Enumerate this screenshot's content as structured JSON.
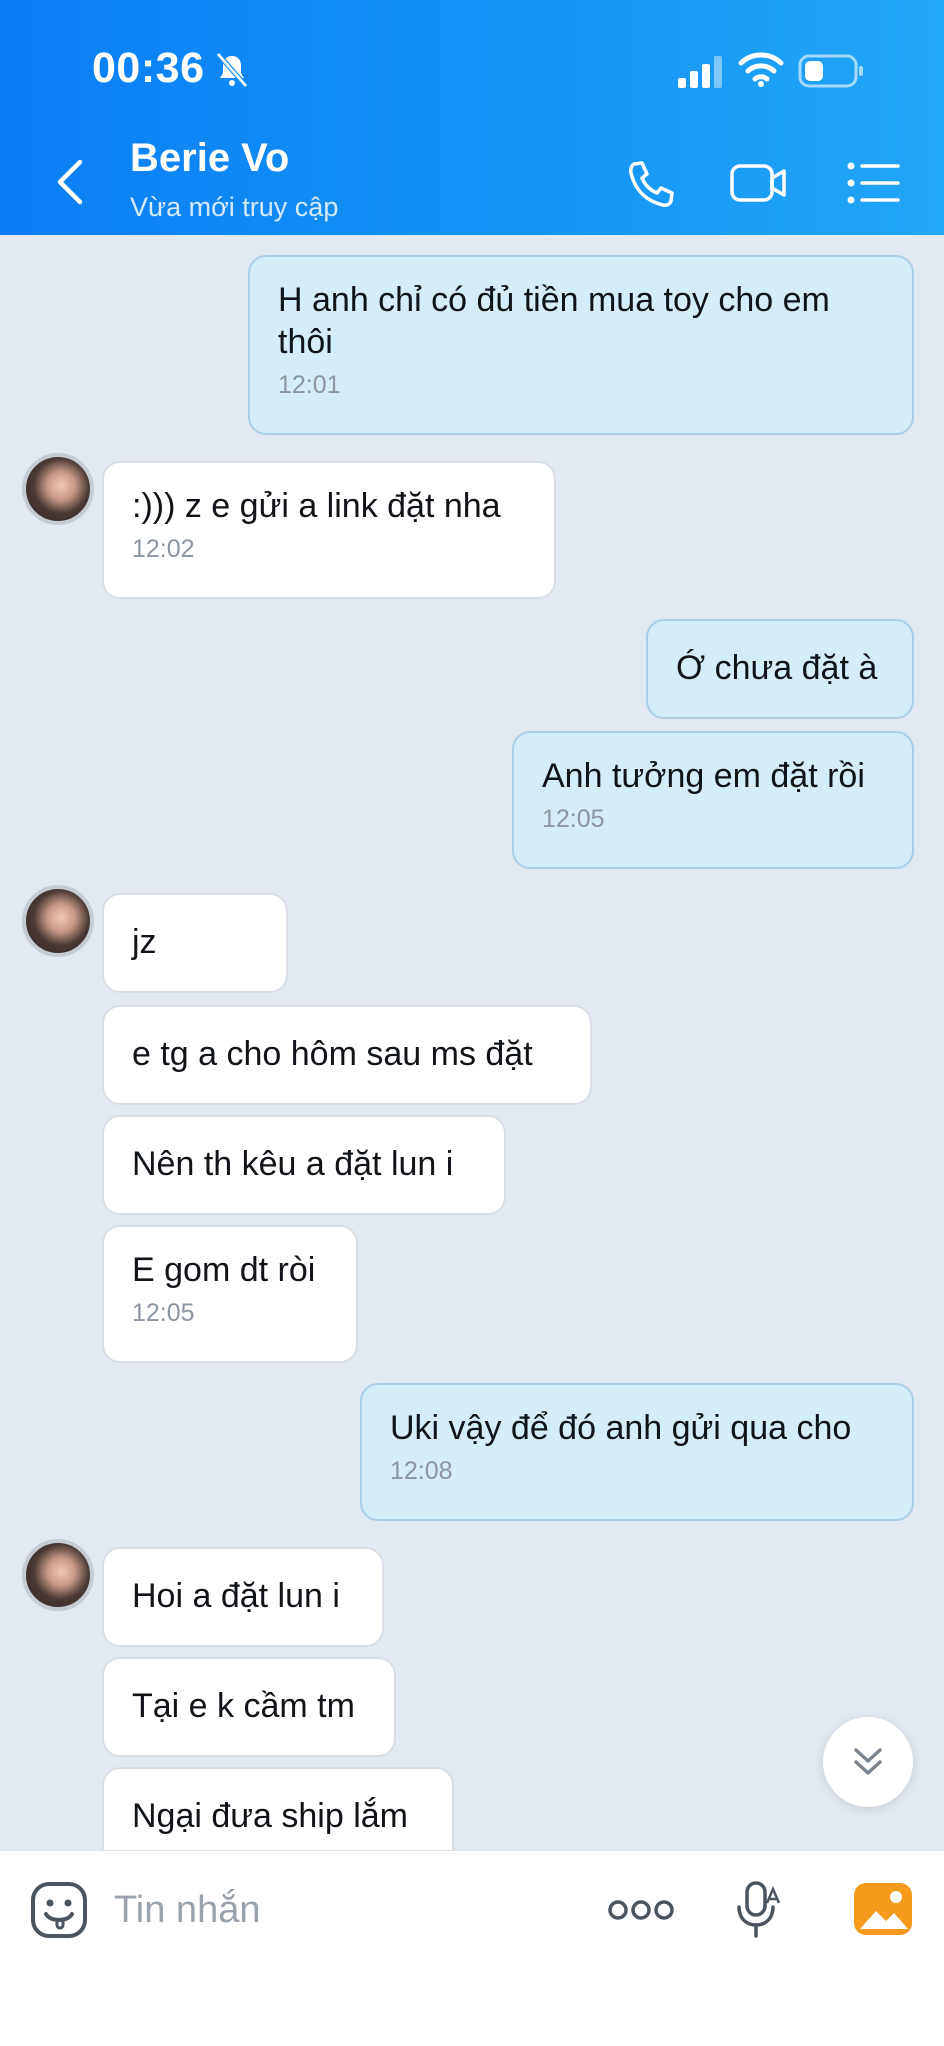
{
  "status": {
    "time": "00:36"
  },
  "header": {
    "name": "Berie Vo",
    "status": "Vừa mới truy cập"
  },
  "messages": [
    {
      "text": "H anh chỉ có đủ tiền mua toy cho em thôi",
      "line1": "H anh chỉ có đủ tiền mua toy cho em",
      "line2": "thôi",
      "time": "12:01"
    },
    {
      "text": ":))) z e gửi a link đặt nha",
      "time": "12:02"
    },
    {
      "text": "Ớ chưa đặt à"
    },
    {
      "text": "Anh tưởng em đặt rồi",
      "time": "12:05"
    },
    {
      "text": "jz"
    },
    {
      "text": "e tg a cho hôm sau ms đặt"
    },
    {
      "text": "Nên th kêu a đặt lun i"
    },
    {
      "text": "E gom dt ròi",
      "time": "12:05"
    },
    {
      "text": "Uki vậy để đó anh gửi qua cho",
      "time": "12:08"
    },
    {
      "text": "Hoi a đặt lun i"
    },
    {
      "text": "Tại e k cầm tm"
    },
    {
      "text": "Ngại đưa ship lắm"
    }
  ],
  "composer": {
    "placeholder": "Tin nhắn"
  },
  "colors": {
    "header": "#0a7ef5",
    "outgoing": "#d4edfb",
    "incoming": "#ffffff",
    "background": "#e2e9f1"
  }
}
